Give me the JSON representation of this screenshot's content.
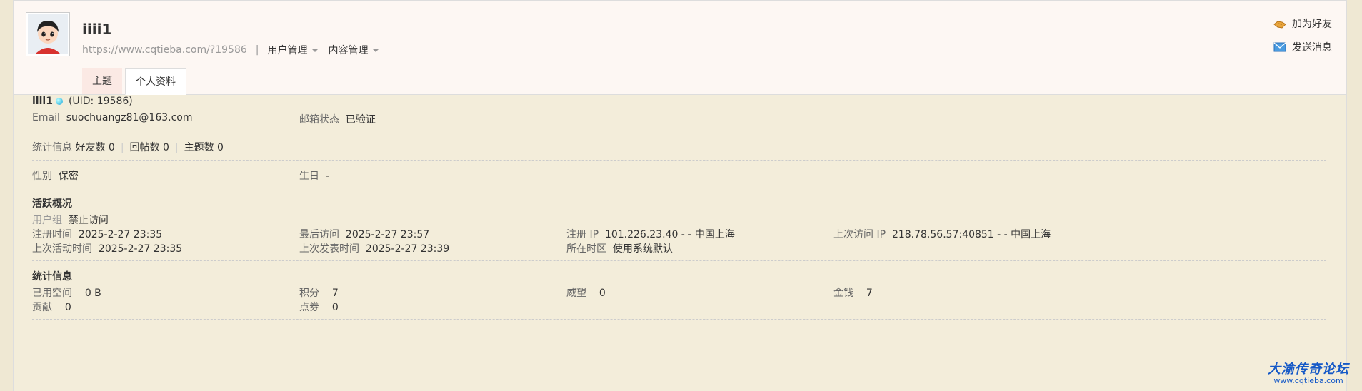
{
  "profile": {
    "username": "iiii1",
    "url": "https://www.cqtieba.com/?19586",
    "menus": [
      "用户管理",
      "内容管理"
    ]
  },
  "tabs": [
    {
      "label": "主题",
      "active": false
    },
    {
      "label": "个人资料",
      "active": true
    }
  ],
  "actions": {
    "add_friend": "加为好友",
    "send_message": "发送消息"
  },
  "details": {
    "name": "iiii1",
    "uid": "(UID: 19586)",
    "email_label": "Email",
    "email": "suochuangz81@163.com",
    "email_status_label": "邮箱状态",
    "email_status": "已验证",
    "stats_label": "统计信息",
    "friends": "好友数 0",
    "replies": "回帖数 0",
    "threads": "主题数 0",
    "gender_label": "性别",
    "gender": "保密",
    "birthday_label": "生日",
    "birthday": "-"
  },
  "activity": {
    "heading": "活跃概况",
    "group_label": "用户组",
    "group": "禁止访问",
    "reg_time_label": "注册时间",
    "reg_time": "2025-2-27 23:35",
    "last_visit_label": "最后访问",
    "last_visit": "2025-2-27 23:57",
    "reg_ip_label": "注册 IP",
    "reg_ip": "101.226.23.40 - - 中国上海",
    "last_ip_label": "上次访问 IP",
    "last_ip": "218.78.56.57:40851 - - 中国上海",
    "last_active_label": "上次活动时间",
    "last_active": "2025-2-27 23:35",
    "last_post_label": "上次发表时间",
    "last_post": "2025-2-27 23:39",
    "timezone_label": "所在时区",
    "timezone": "使用系统默认"
  },
  "statistics": {
    "heading": "统计信息",
    "space_label": "已用空间",
    "space": "0 B",
    "points_label": "积分",
    "points": "7",
    "prestige_label": "威望",
    "prestige": "0",
    "money_label": "金钱",
    "money": "7",
    "contribution_label": "贡献",
    "contribution": "0",
    "coupons_label": "点券",
    "coupons": "0"
  },
  "watermark": {
    "title": "大渝传奇论坛",
    "url": "www.cqtieba.com"
  },
  "colors": {
    "page_bg": "#efe8d3",
    "header_bg": "#fdf7f3",
    "link_blue": "#1559c7",
    "online": "#19a6d9"
  }
}
